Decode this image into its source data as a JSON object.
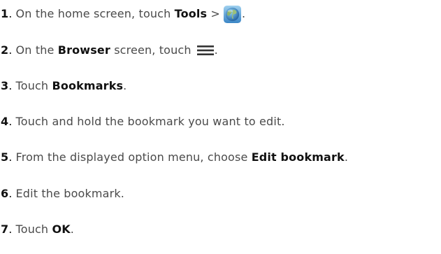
{
  "steps": [
    {
      "number": "1",
      "text_before": "On the home screen, touch ",
      "bold": "Tools",
      "text_after": " >",
      "icon": "browser-globe-icon",
      "end": "."
    },
    {
      "number": "2",
      "text_before": "On the ",
      "bold": "Browser",
      "text_after": " screen, touch",
      "icon": "menu-icon",
      "end": "."
    },
    {
      "number": "3",
      "text_before": "Touch ",
      "bold": "Bookmarks",
      "end": "."
    },
    {
      "number": "4",
      "text_before": "Touch and hold the bookmark you want to edit."
    },
    {
      "number": "5",
      "text_before": "From the displayed option menu, choose ",
      "bold": "Edit bookmark",
      "end": "."
    },
    {
      "number": "6",
      "text_before": "Edit the bookmark."
    },
    {
      "number": "7",
      "text_before": "Touch ",
      "bold": "OK",
      "end": "."
    }
  ],
  "colors": {
    "text": "#4a4a4a",
    "emphasis": "#111111",
    "menu_icon": "#333333"
  }
}
